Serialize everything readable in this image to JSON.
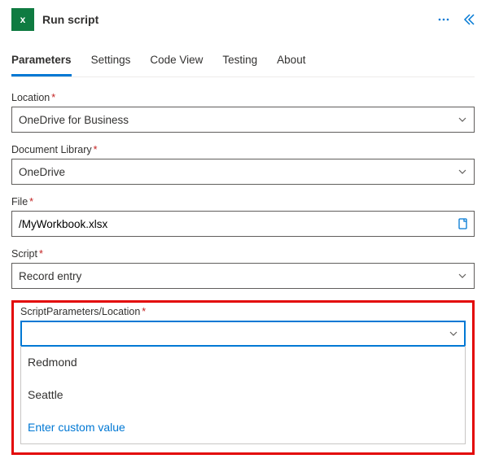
{
  "header": {
    "icon_letter": "x",
    "title": "Run script"
  },
  "tabs": [
    {
      "label": "Parameters",
      "active": true
    },
    {
      "label": "Settings"
    },
    {
      "label": "Code View"
    },
    {
      "label": "Testing"
    },
    {
      "label": "About"
    }
  ],
  "fields": {
    "location": {
      "label": "Location",
      "value": "OneDrive for Business"
    },
    "library": {
      "label": "Document Library",
      "value": "OneDrive"
    },
    "file": {
      "label": "File",
      "value": "/MyWorkbook.xlsx"
    },
    "script": {
      "label": "Script",
      "value": "Record entry"
    },
    "param_location": {
      "label": "ScriptParameters/Location",
      "value": "",
      "options": [
        "Redmond",
        "Seattle"
      ],
      "custom": "Enter custom value"
    }
  }
}
